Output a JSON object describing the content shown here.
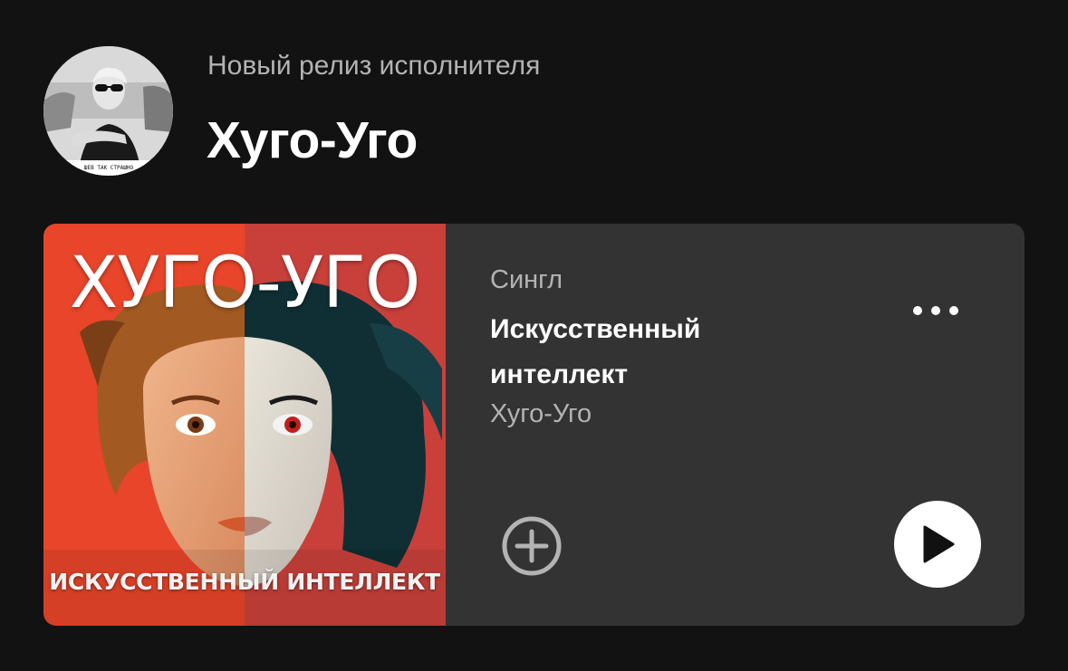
{
  "header": {
    "caption": "Новый релиз исполнителя",
    "artist_name": "Хуго-Уго",
    "avatar_caption": "ШЕВ ТАК СТРАШНО"
  },
  "release": {
    "type_label": "Сингл",
    "title": "Искусственный интеллект",
    "artist": "Хуго-Уго",
    "cover": {
      "title": "ХУГО-УГО",
      "subtitle": "ИСКУССТВЕННЫЙ ИНТЕЛЛЕКТ"
    }
  },
  "icons": {
    "more": "more-options-icon",
    "add": "add-circle-icon",
    "play": "play-icon"
  },
  "colors": {
    "background": "#121212",
    "card": "#333333",
    "text_primary": "#ffffff",
    "text_secondary": "#b3b3b3",
    "cover_left": "#e8452a",
    "cover_right": "#c9403b"
  }
}
